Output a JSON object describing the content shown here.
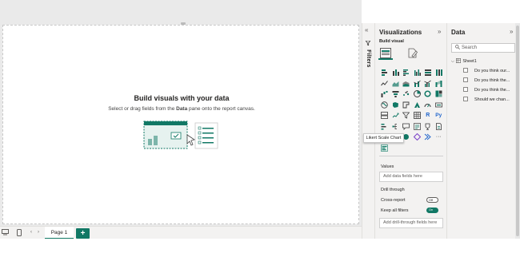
{
  "canvas": {
    "empty_title": "Build visuals with your data",
    "empty_sub_pre": "Select or drag fields from the ",
    "empty_sub_bold": "Data",
    "empty_sub_post": " pane onto the report canvas."
  },
  "page_bar": {
    "page_tab": "Page 1",
    "add_page": "+"
  },
  "filters": {
    "label": "Filters",
    "chevron": "«"
  },
  "visualizations": {
    "title": "Visualizations",
    "collapse": "»",
    "build_label": "Build visual",
    "grid_text_icons": [
      "R",
      "Py"
    ],
    "more": "···",
    "tooltip": "Likert Scale Chart",
    "values_label": "Values",
    "values_placeholder": "Add data fields here",
    "drill_label": "Drill through",
    "cross_report_label": "Cross-report",
    "cross_report_state": "Off",
    "keep_filters_label": "Keep all filters",
    "keep_filters_state": "On",
    "drill_placeholder": "Add drill-through fields here"
  },
  "data_pane": {
    "title": "Data",
    "collapse": "»",
    "search_placeholder": "Search",
    "table_name": "Sheet1",
    "fields": [
      "Do you think our...",
      "Do you think the...",
      "Do you think the...",
      "Should we chan..."
    ]
  },
  "colors": {
    "accent": "#117865",
    "pane_bg": "#f3f2f1",
    "canvas_bg": "#eaeaea"
  }
}
